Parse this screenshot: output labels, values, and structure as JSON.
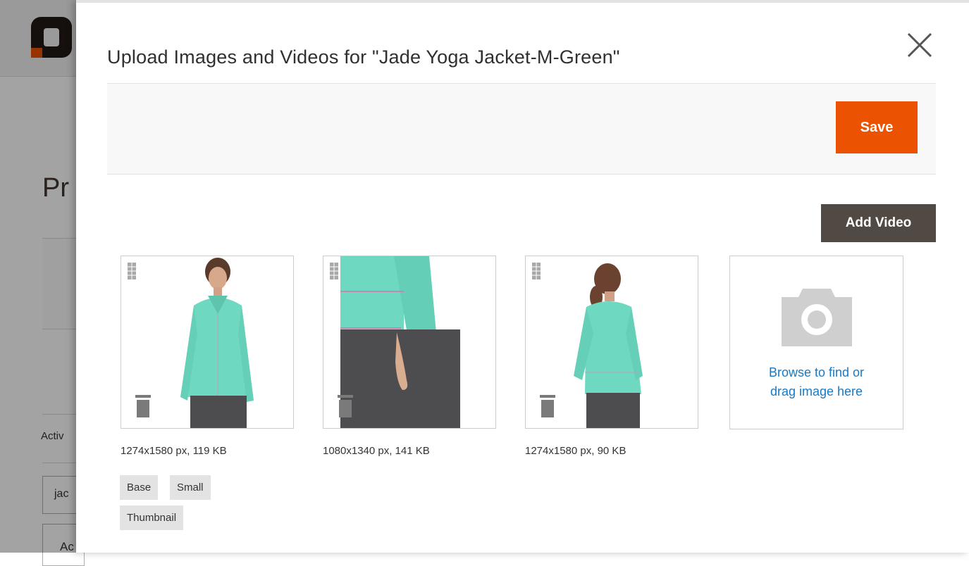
{
  "modal": {
    "title": "Upload Images and Videos for \"Jade Yoga Jacket-M-Green\"",
    "save_label": "Save",
    "add_video_label": "Add Video"
  },
  "images": [
    {
      "meta": "1274x1580 px, 119 KB",
      "roles": [
        "Base",
        "Small",
        "Thumbnail"
      ]
    },
    {
      "meta": "1080x1340 px, 141 KB",
      "roles": []
    },
    {
      "meta": "1274x1580 px, 90 KB",
      "roles": []
    }
  ],
  "uploader": {
    "line1": "Browse to find or",
    "line2": "drag image here"
  },
  "background_page": {
    "title_fragment": "Pr",
    "label_fragment": "Activ",
    "input_fragment": "jac",
    "button_fragment": "Ac"
  },
  "colors": {
    "primary": "#eb5202",
    "secondary": "#514943",
    "link": "#1979c3",
    "jacket": "#6fd8c1"
  }
}
